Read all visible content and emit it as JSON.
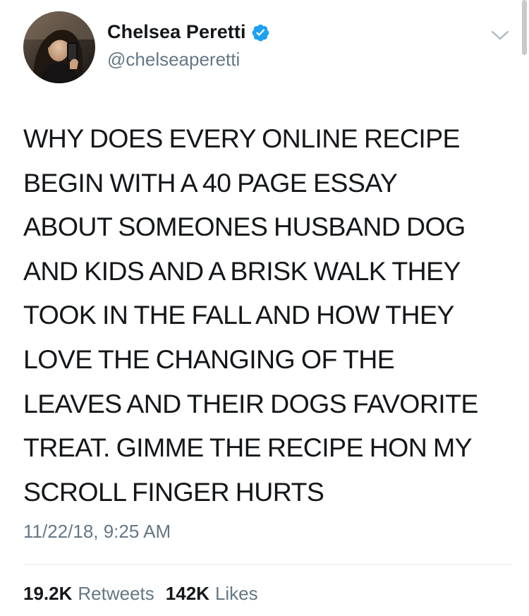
{
  "author": {
    "display_name": "Chelsea Peretti",
    "handle": "@chelseaperetti",
    "verified": true,
    "avatar_icon": "profile-photo"
  },
  "header": {
    "menu_icon": "chevron-down-icon"
  },
  "tweet": {
    "text": "WHY DOES EVERY ONLINE RECIPE\nBEGIN WITH A 40 PAGE ESSAY\nABOUT SOMEONES HUSBAND DOG\nAND KIDS AND A BRISK WALK THEY\nTOOK IN THE FALL AND HOW THEY\nLOVE THE CHANGING OF THE\nLEAVES AND THEIR DOGS FAVORITE\nTREAT. GIMME THE RECIPE HON MY\nSCROLL FINGER HURTS",
    "timestamp": "11/22/18, 9:25 AM"
  },
  "stats": {
    "retweets_count": "19.2K",
    "retweets_label": "Retweets",
    "likes_count": "142K",
    "likes_label": "Likes"
  },
  "colors": {
    "text_primary": "#14171a",
    "text_secondary": "#657786",
    "verified_badge": "#1da1f2",
    "divider": "#e1e8ed"
  }
}
